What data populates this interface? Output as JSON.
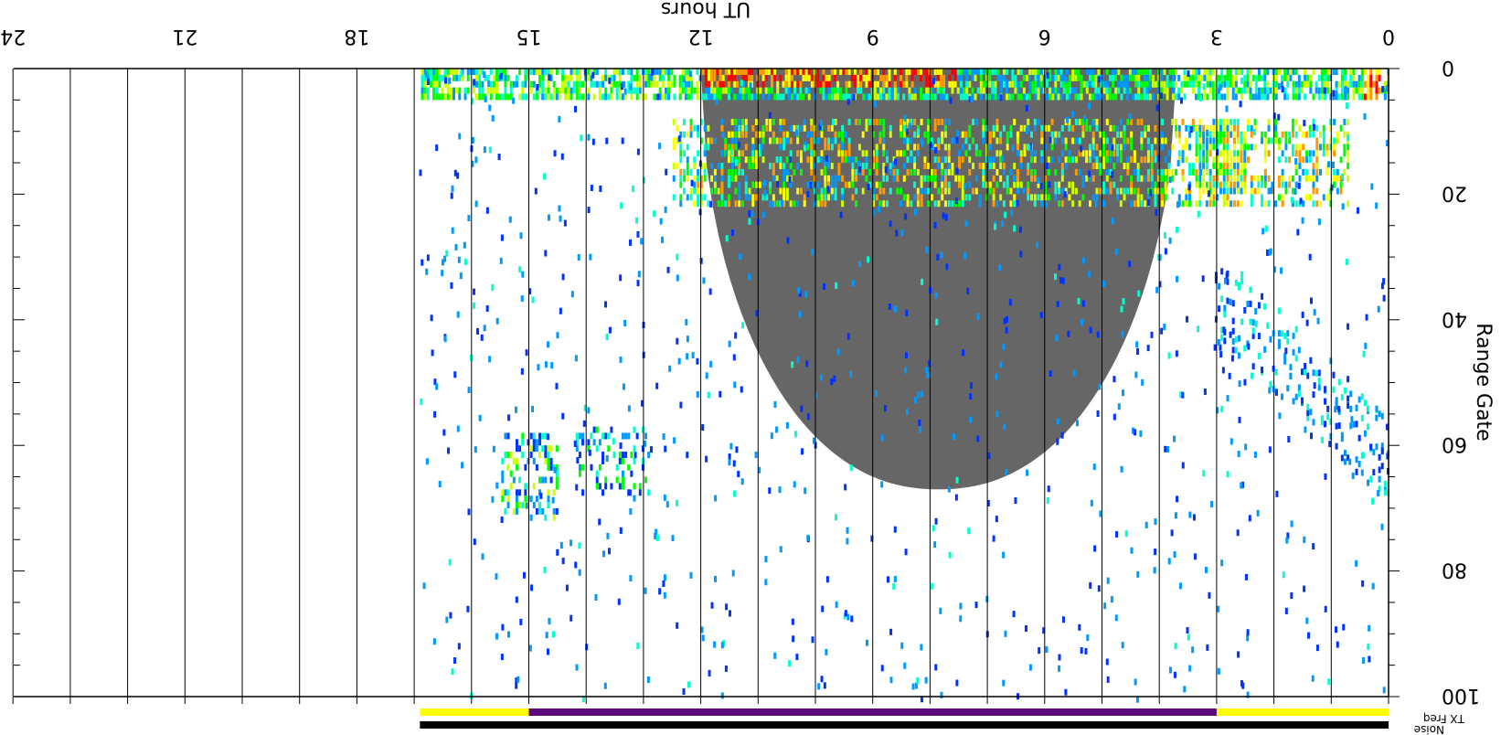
{
  "chart_data": {
    "type": "heatmap",
    "orientation": "rotated-180",
    "xlabel": "UT hours",
    "ylabel": "Range Gate",
    "x_ticks": [
      "0",
      "3",
      "6",
      "9",
      "12",
      "15",
      "18",
      "21",
      "24"
    ],
    "y_ticks": [
      "0",
      "20",
      "40",
      "60",
      "80",
      "100"
    ],
    "xlim": [
      0,
      24
    ],
    "ylim": [
      0,
      100
    ],
    "data_extent_hours": [
      0,
      16.9
    ],
    "grid": "vertical lines every 1 hour",
    "colors": {
      "ground_scatter": "#666666",
      "scale": [
        "#0033ff",
        "#0099ff",
        "#00ffcc",
        "#00ff00",
        "#ccff00",
        "#ffff00",
        "#ff9900",
        "#ff0000"
      ],
      "tx_freq_primary": "#ffff00",
      "tx_freq_secondary": "#5a0a7a",
      "noise_bar": "#000000"
    },
    "bars": {
      "tx_freq_label": "TX Freq",
      "noise_label": "Noise",
      "tx_freq_segments": [
        {
          "from": 0,
          "to": 3,
          "color": "yellow"
        },
        {
          "from": 3,
          "to": 15,
          "color": "purple"
        },
        {
          "from": 15,
          "to": 16.9,
          "color": "yellow"
        }
      ],
      "noise_segment": {
        "from": 0,
        "to": 16.9
      }
    },
    "features": [
      {
        "name": "near-range band",
        "hours": [
          0,
          16.9
        ],
        "gates": [
          0,
          5
        ],
        "intensity": "high"
      },
      {
        "name": "ground scatter",
        "hours": [
          3.7,
          12
        ],
        "gates": [
          0,
          67
        ],
        "type": "ground"
      },
      {
        "name": "mid-range echoes",
        "hours": [
          0.7,
          12.5
        ],
        "gates": [
          8,
          22
        ],
        "intensity": "high"
      },
      {
        "name": "descending band",
        "hours": [
          0,
          3
        ],
        "gates": [
          38,
          67
        ],
        "intensity": "medium"
      },
      {
        "name": "late patch",
        "hours": [
          14.5,
          15.5
        ],
        "gates": [
          58,
          72
        ],
        "intensity": "medium"
      }
    ]
  }
}
